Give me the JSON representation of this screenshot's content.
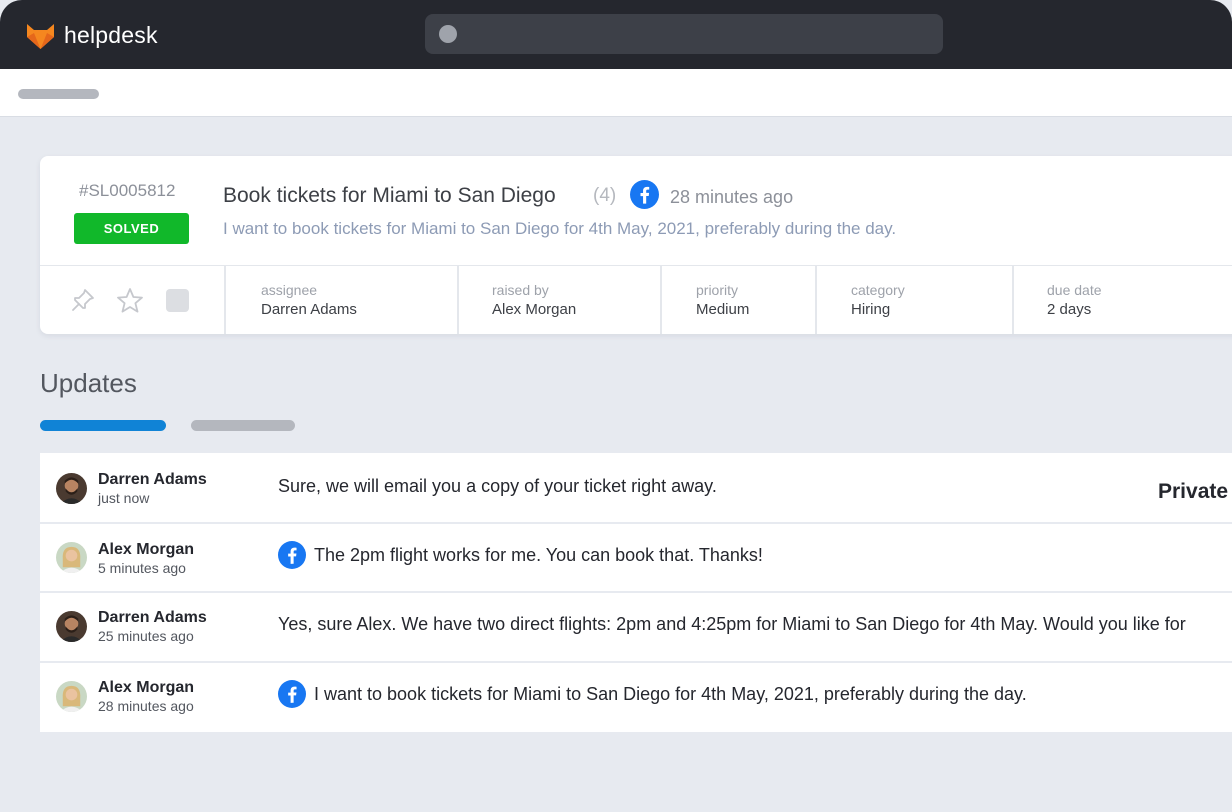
{
  "app": {
    "name": "helpdesk"
  },
  "colors": {
    "topbar": "#25272e",
    "accent": "#1083d6",
    "solved": "#11b82a",
    "facebook": "#1877f2",
    "logo_orange": "#f5871f"
  },
  "ticket": {
    "id": "#SL0005812",
    "status": "SOLVED",
    "title": "Book tickets for Miami to San Diego",
    "count": "(4)",
    "source_icon": "facebook-icon",
    "time": "28 minutes ago",
    "description": "I want to book tickets for Miami to San Diego for 4th May, 2021, preferably during the day.",
    "fields": [
      {
        "label": "assignee",
        "value": "Darren Adams"
      },
      {
        "label": "raised by",
        "value": "Alex Morgan"
      },
      {
        "label": "priority",
        "value": "Medium"
      },
      {
        "label": "category",
        "value": "Hiring"
      },
      {
        "label": "due date",
        "value": "2 days"
      }
    ]
  },
  "updates": {
    "title": "Updates",
    "items": [
      {
        "name": "Darren Adams",
        "time": "just now",
        "message": "Sure, we will email you a copy of your ticket right away.",
        "badge": "Private",
        "source": "none"
      },
      {
        "name": "Alex Morgan",
        "time": "5 minutes ago",
        "message": "The 2pm flight works for me. You can book that. Thanks!",
        "source": "facebook-icon"
      },
      {
        "name": "Darren Adams",
        "time": "25 minutes ago",
        "message": "Yes, sure Alex. We have two direct flights: 2pm and 4:25pm for Miami to San Diego for 4th May. Would you like for",
        "source": "none"
      },
      {
        "name": "Alex Morgan",
        "time": "28 minutes ago",
        "message": "I want to book tickets for Miami to San Diego for 4th May, 2021, preferably during the day.",
        "source": "facebook-icon"
      }
    ]
  }
}
